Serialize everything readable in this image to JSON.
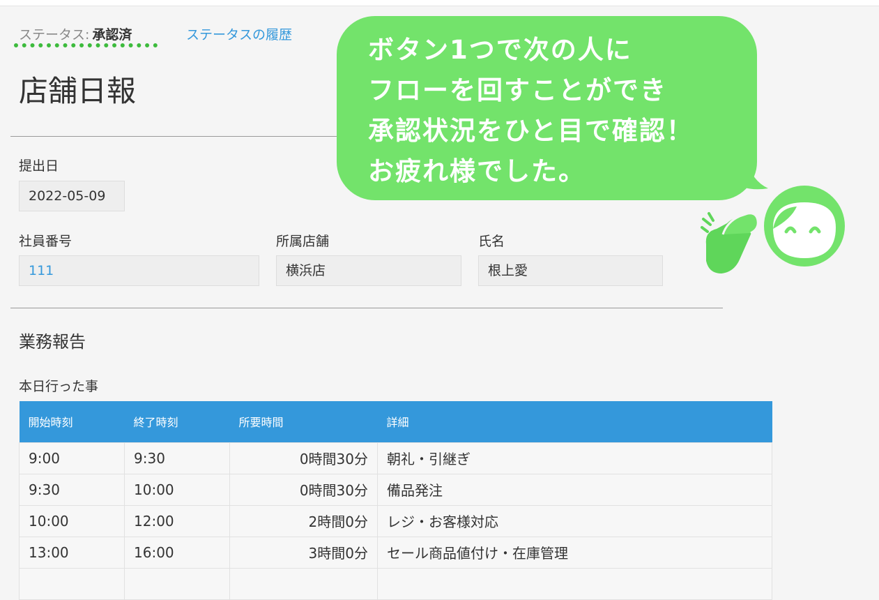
{
  "status": {
    "label": "ステータス:",
    "value": "承認済",
    "history_link": "ステータスの履歴"
  },
  "page_title": "店舗日報",
  "fields": {
    "submit_date": {
      "label": "提出日",
      "value": "2022-05-09"
    },
    "employee_number": {
      "label": "社員番号",
      "value": "111"
    },
    "store": {
      "label": "所属店舗",
      "value": "横浜店"
    },
    "name": {
      "label": "氏名",
      "value": "根上愛"
    }
  },
  "report": {
    "section_title": "業務報告",
    "table_title": "本日行った事",
    "columns": [
      "開始時刻",
      "終了時刻",
      "所要時間",
      "詳細"
    ],
    "rows": [
      {
        "start": "9:00",
        "end": "9:30",
        "duration": "0時間30分",
        "detail": "朝礼・引継ぎ"
      },
      {
        "start": "9:30",
        "end": "10:00",
        "duration": "0時間30分",
        "detail": "備品発注"
      },
      {
        "start": "10:00",
        "end": "12:00",
        "duration": "2時間0分",
        "detail": "レジ・お客様対応"
      },
      {
        "start": "13:00",
        "end": "16:00",
        "duration": "3時間0分",
        "detail": "セール商品値付け・在庫管理"
      }
    ]
  },
  "speech_bubble": {
    "lines": [
      "ボタン1つで次の人に",
      "フローを回すことができ",
      "承認状況をひと目で確認！",
      "お疲れ様でした。"
    ]
  },
  "colors": {
    "accent_blue": "#3498db",
    "bubble_green": "#73e36b",
    "status_green": "#3dbb3d"
  },
  "icons": [
    "smiling-mascot-icon",
    "clapping-hands-icon"
  ]
}
